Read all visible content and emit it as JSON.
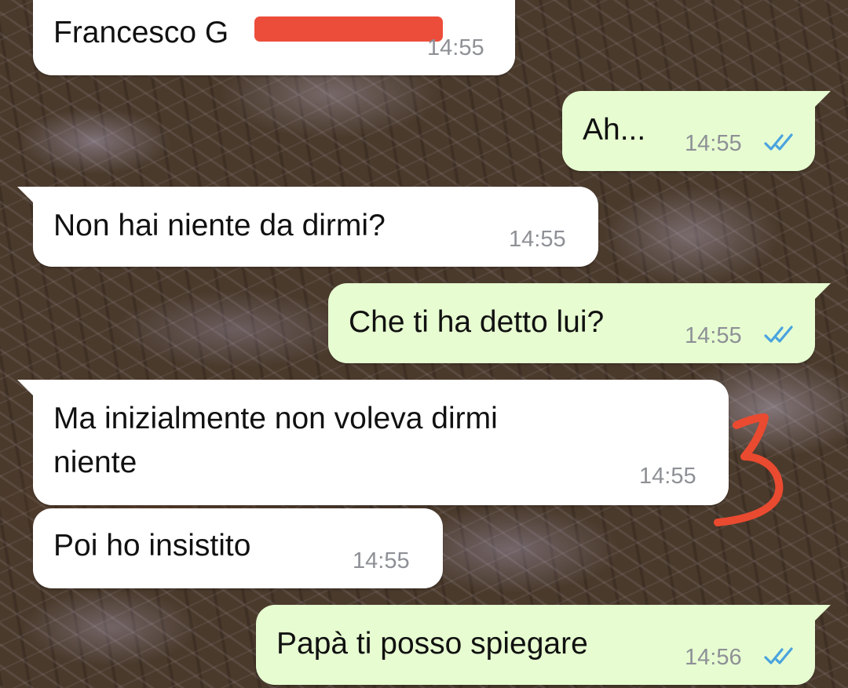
{
  "colors": {
    "incoming_bubble": "#ffffff",
    "outgoing_bubble": "#e7fdd1",
    "text": "#111111",
    "timestamp": "#8e9096",
    "read_receipt": "#4aa3df",
    "redaction_mark": "#ec4d3b",
    "annotation": "#ea4a30"
  },
  "messages": [
    {
      "direction": "incoming",
      "text": "Francesco G",
      "time": "14:55",
      "redacted_suffix": true
    },
    {
      "direction": "outgoing",
      "text": "Ah...",
      "time": "14:55",
      "status_icon": "double-check-icon"
    },
    {
      "direction": "incoming",
      "text": "Non hai niente da dirmi?",
      "time": "14:55"
    },
    {
      "direction": "outgoing",
      "text": "Che ti ha detto lui?",
      "time": "14:55",
      "status_icon": "double-check-icon"
    },
    {
      "direction": "incoming",
      "text": "Ma inizialmente non voleva dirmi",
      "text_line2": "niente",
      "time": "14:55"
    },
    {
      "direction": "incoming",
      "text": "Poi ho insistito",
      "time": "14:55"
    },
    {
      "direction": "outgoing",
      "text": "Papà ti posso spiegare",
      "time": "14:56",
      "status_icon": "double-check-icon"
    }
  ],
  "annotation": {
    "text": "3",
    "icon": "handwritten-3-mark"
  }
}
